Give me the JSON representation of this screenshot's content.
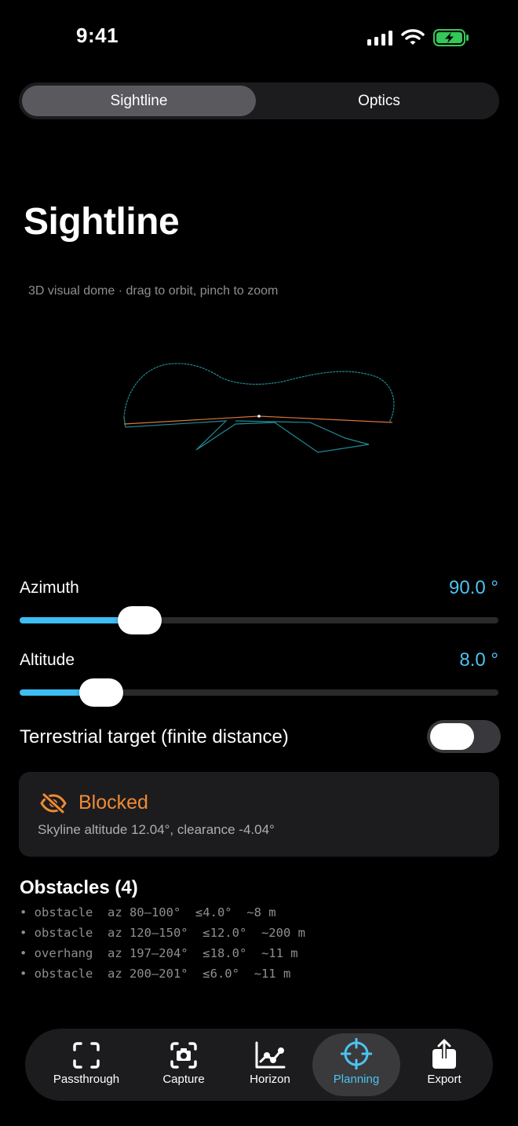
{
  "status_bar": {
    "time": "9:41"
  },
  "segments": [
    {
      "label": "Sightline",
      "selected": true
    },
    {
      "label": "Optics",
      "selected": false
    }
  ],
  "title": "Sightline",
  "subtitle": "3D visual dome · drag to orbit, pinch to zoom",
  "azimuth": {
    "label": "Azimuth",
    "value": "90.0 °",
    "fraction": 0.25
  },
  "altitude": {
    "label": "Altitude",
    "value": "8.0 °",
    "fraction": 0.17
  },
  "terrestrial": {
    "label": "Terrestrial target (finite distance)",
    "on": false
  },
  "status": {
    "title": "Blocked",
    "detail": "Skyline altitude 12.04°, clearance -4.04°",
    "color": "#f08a35",
    "icon": "eye-slash-icon"
  },
  "obstacles": {
    "heading": "Obstacles (4)",
    "items": [
      "• obstacle  az 80–100°  ≤4.0°  ~8 m",
      "• obstacle  az 120–150°  ≤12.0°  ~200 m",
      "• overhang  az 197–204°  ≤18.0°  ~11 m",
      "• obstacle  az 200–201°  ≤6.0°  ~11 m"
    ]
  },
  "tabs": [
    {
      "label": "Passthrough",
      "icon": "viewfinder-icon",
      "active": false
    },
    {
      "label": "Capture",
      "icon": "camera-icon",
      "active": false
    },
    {
      "label": "Horizon",
      "icon": "line-chart-icon",
      "active": false
    },
    {
      "label": "Planning",
      "icon": "crosshair-icon",
      "active": true
    },
    {
      "label": "Export",
      "icon": "share-icon",
      "active": false
    }
  ],
  "colors": {
    "accent": "#4cc3f0",
    "blocked": "#f08a35",
    "dome_outline": "#1f8a94",
    "sightline": "#d8743a"
  }
}
